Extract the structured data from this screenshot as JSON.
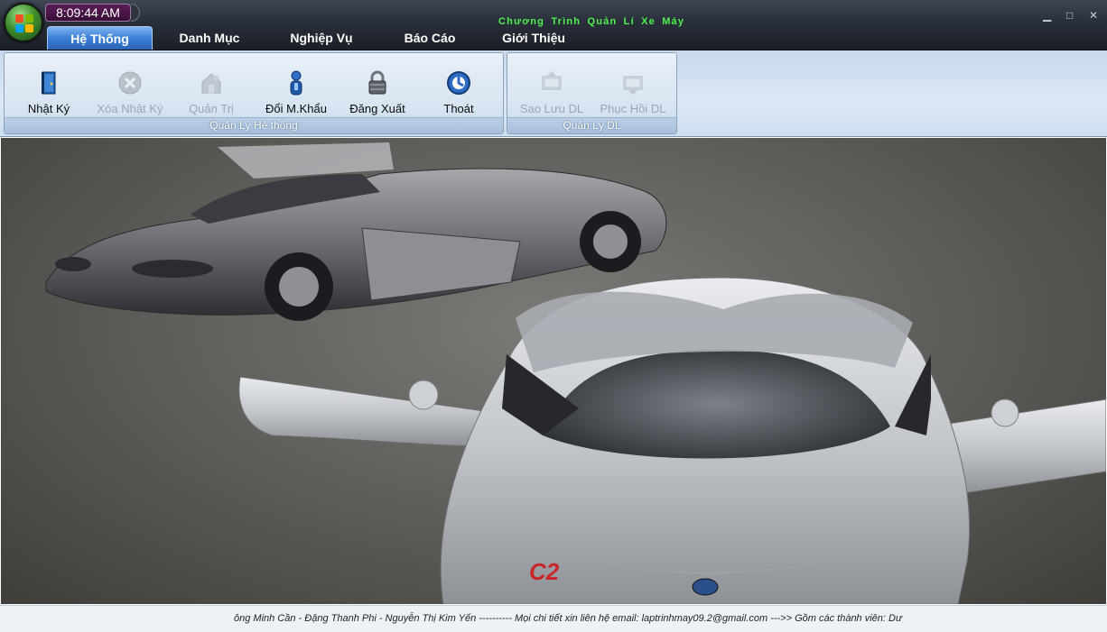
{
  "window": {
    "title": "Chương Trình Quản Lí Xe Máy",
    "clock": "8:09:44 AM",
    "controls": {
      "minimize": "▁",
      "maximize": "□",
      "close": "✕"
    }
  },
  "tabs": [
    {
      "label": "Hệ Thống",
      "active": true
    },
    {
      "label": "Danh Mục"
    },
    {
      "label": "Nghiệp Vụ"
    },
    {
      "label": "Báo Cáo"
    },
    {
      "label": "Giới Thiệu"
    }
  ],
  "ribbon": {
    "system_group": {
      "caption": "Quản Lý Hệ thống",
      "buttons": [
        {
          "label": "Nhật Ký",
          "icon": "book-icon",
          "enabled": true
        },
        {
          "label": "Xóa Nhật Ký",
          "icon": "delete-icon",
          "enabled": false
        },
        {
          "label": "Quản Trị",
          "icon": "admin-icon",
          "enabled": false
        },
        {
          "label": "Đổi M.Khẩu",
          "icon": "user-key-icon",
          "enabled": true
        },
        {
          "label": "Đăng Xuất",
          "icon": "lock-icon",
          "enabled": true
        },
        {
          "label": "Thoát",
          "icon": "exit-icon",
          "enabled": true
        }
      ]
    },
    "data_group": {
      "caption": "Quản Lý DL",
      "buttons": [
        {
          "label": "Sao Lưu DL",
          "icon": "backup-icon",
          "enabled": false
        },
        {
          "label": "Phục Hồi DL",
          "icon": "restore-icon",
          "enabled": false
        }
      ]
    }
  },
  "status": {
    "text": "ông Minh Cần  - Đặng Thanh Phi - Nguyễn Thị Kim Yến ---------- Mọi chi tiết xin liên hệ email: laptrinhmay09.2@gmail.com --->> Gồm các thành viên: Dư"
  },
  "colors": {
    "title_green": "#4ef24e",
    "tab_active": "#3b7fd6",
    "clock_bg": "#5a1e56"
  }
}
